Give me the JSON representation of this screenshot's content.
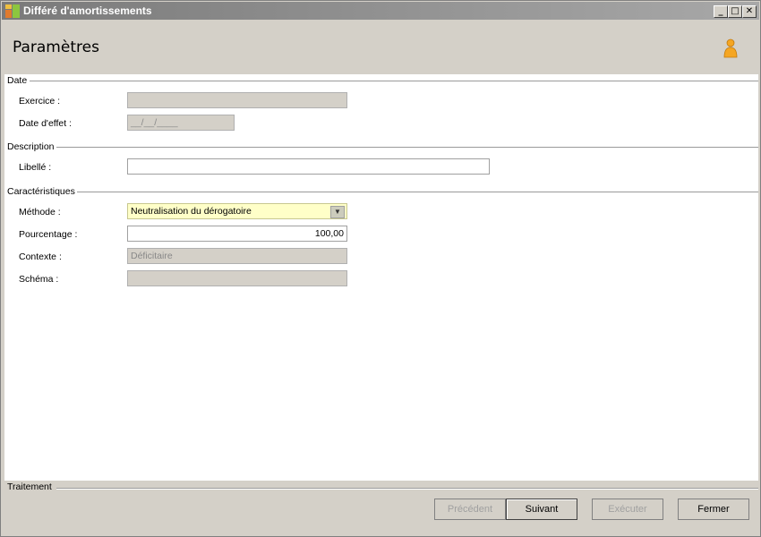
{
  "window": {
    "title": "Différé d'amortissements",
    "minimize": "_",
    "maximize": "□",
    "close": "✕"
  },
  "header": {
    "title": "Paramètres"
  },
  "sections": {
    "date": {
      "title": "Date",
      "exercice_label": "Exercice :",
      "exercice_value": "",
      "date_effet_label": "Date d'effet :",
      "date_effet_value": "__/__/____"
    },
    "description": {
      "title": "Description",
      "libelle_label": "Libellé :",
      "libelle_value": ""
    },
    "caracteristiques": {
      "title": "Caractéristiques",
      "methode_label": "Méthode :",
      "methode_value": "Neutralisation du dérogatoire",
      "pourcentage_label": "Pourcentage :",
      "pourcentage_value": "100,00",
      "contexte_label": "Contexte :",
      "contexte_value": "Déficitaire",
      "schema_label": "Schéma :",
      "schema_value": ""
    }
  },
  "footer": {
    "title": "Traitement",
    "buttons": {
      "precedent": "Précédent",
      "suivant": "Suivant",
      "executer": "Exécuter",
      "fermer": "Fermer"
    }
  },
  "icons": {
    "app": "app-logo-icon",
    "user": "user-icon"
  },
  "colors": {
    "select_bg": "#ffffc8",
    "readonly_bg": "#d4d0c8"
  }
}
